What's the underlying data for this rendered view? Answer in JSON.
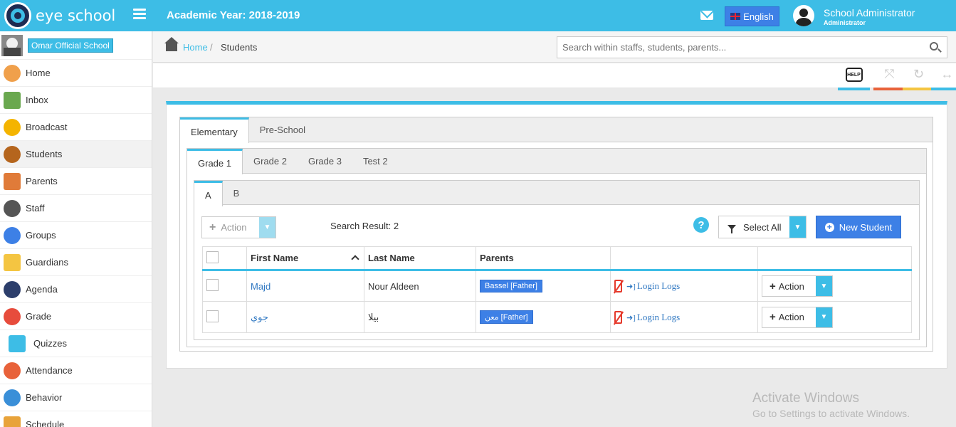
{
  "app": {
    "brand": "eye school",
    "academic_year": "Academic Year: 2018-2019"
  },
  "header": {
    "language": "English",
    "user_name": "School Administrator",
    "user_role": "Administrator"
  },
  "sidebar": {
    "school_name": "Omar Official School",
    "items": [
      {
        "label": "Home",
        "icon": "home-icon",
        "color": "#f0a04b"
      },
      {
        "label": "Inbox",
        "icon": "inbox-icon",
        "color": "#6aa84f"
      },
      {
        "label": "Broadcast",
        "icon": "broadcast-icon",
        "color": "#f4b400"
      },
      {
        "label": "Students",
        "icon": "students-icon",
        "color": "#b5651d"
      },
      {
        "label": "Parents",
        "icon": "parents-icon",
        "color": "#e07b39"
      },
      {
        "label": "Staff",
        "icon": "staff-icon",
        "color": "#555555"
      },
      {
        "label": "Groups",
        "icon": "groups-icon",
        "color": "#3d80e6"
      },
      {
        "label": "Guardians",
        "icon": "guardians-icon",
        "color": "#f4c542"
      },
      {
        "label": "Agenda",
        "icon": "agenda-icon",
        "color": "#2c3e6b"
      },
      {
        "label": "Grade",
        "icon": "grade-icon",
        "color": "#e74c3c"
      },
      {
        "label": "Quizzes",
        "icon": "quizzes-icon",
        "color": "#3dbde6"
      },
      {
        "label": "Attendance",
        "icon": "attendance-icon",
        "color": "#e8623a"
      },
      {
        "label": "Behavior",
        "icon": "behavior-icon",
        "color": "#3a8fd8"
      },
      {
        "label": "Schedule",
        "icon": "schedule-icon",
        "color": "#e8a33a"
      }
    ]
  },
  "breadcrumb": {
    "home": "Home",
    "separator": "/",
    "current": "Students"
  },
  "search": {
    "placeholder": "Search within staffs, students, parents..."
  },
  "tools": {
    "help_label": "HELP"
  },
  "tabs": {
    "level1": [
      "Elementary",
      "Pre-School"
    ],
    "level2": [
      "Grade 1",
      "Grade 2",
      "Grade 3",
      "Test 2"
    ],
    "level3": [
      "A",
      "B"
    ]
  },
  "toolbar": {
    "action_label": "Action",
    "search_result": "Search Result: 2",
    "select_all": "Select All",
    "new_student": "New Student"
  },
  "table": {
    "headers": [
      "First Name",
      "Last Name",
      "Parents"
    ],
    "rows": [
      {
        "first_name": "Majd",
        "last_name": "Nour Aldeen",
        "parent": "Bassel   [Father]",
        "login_logs": "Login Logs",
        "action": "Action"
      },
      {
        "first_name": "جوي",
        "last_name": "بيلا",
        "parent": "معن   [Father]",
        "login_logs": "Login Logs",
        "action": "Action"
      }
    ]
  },
  "watermark": {
    "line1": "Activate Windows",
    "line2": "Go to Settings to activate Windows."
  },
  "colors": {
    "accent": "#3dbde6",
    "primary_button": "#3d80e6",
    "link": "#3078c2",
    "danger": "#e53a2c"
  }
}
